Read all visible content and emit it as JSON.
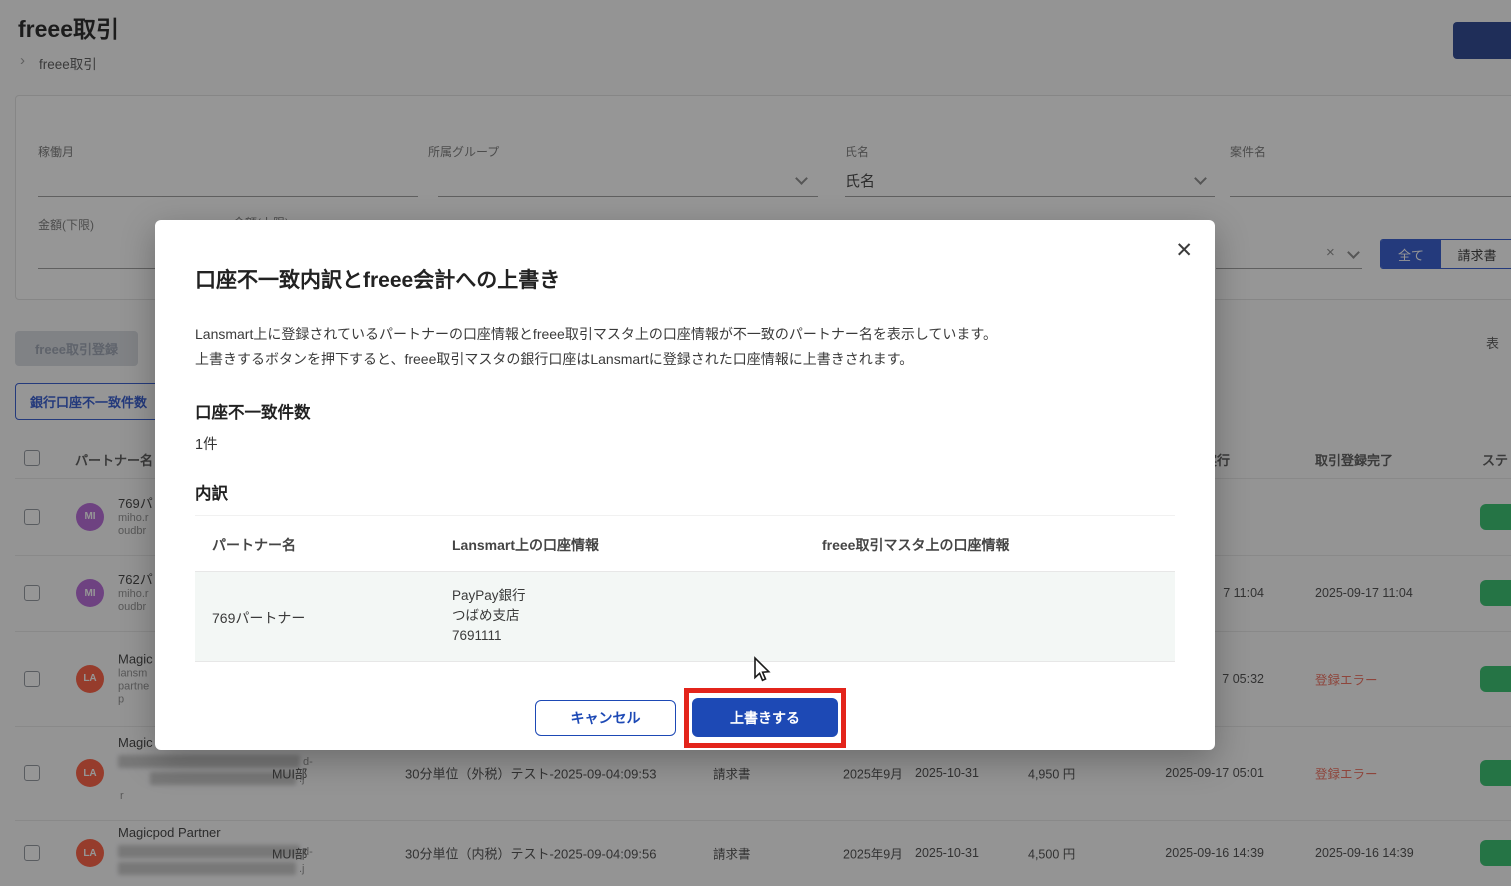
{
  "colors": {
    "accent_blue": "#1d49b5",
    "badge_green": "#2fc06a",
    "error_red": "#f06a58",
    "annotation_red": "#e3241b",
    "avatar_purple": "#b565d9",
    "avatar_red": "#ff5a3c"
  },
  "icons": {
    "breadcrumb_arrow": "›",
    "close": "✕",
    "clear": "×",
    "chevron_down": "chevron-down"
  },
  "header": {
    "title": "freee取引",
    "breadcrumb": "freee取引"
  },
  "filters": {
    "working_month_label": "稼働月",
    "group_label": "所属グループ",
    "name_label": "氏名",
    "name_value": "氏名",
    "project_label": "案件名",
    "amount_lower_label": "金額(下限)",
    "amount_upper_label": "金額(上限)",
    "clear_icon": "×"
  },
  "tabs": {
    "all": "全て",
    "invoice": "請求書"
  },
  "toolbar": {
    "freee_register_label": "freee取引登録",
    "bank_mismatch_label": "銀行口座不一致件数",
    "display_fragment": "表"
  },
  "bg_table": {
    "headers": {
      "partner": "パートナー名",
      "exec_fragment": "実行",
      "registered": "取引登録完了",
      "status_fragment": "ステ"
    },
    "rows": [
      {
        "avatar": "MI",
        "name": "769パ",
        "email1": "miho.r",
        "email2": "oudbr",
        "email3": "",
        "group": "",
        "subject": "",
        "type": "",
        "month": "",
        "due": "",
        "amount": "",
        "exec": "",
        "registered": "",
        "error": false
      },
      {
        "avatar": "MI",
        "name": "762パ",
        "email1": "miho.r",
        "email2": "oudbr",
        "email3": "",
        "group": "",
        "subject": "",
        "type": "",
        "month": "",
        "due": "",
        "amount": "",
        "exec": "7 11:04",
        "registered": "2025-09-17 11:04",
        "error": false
      },
      {
        "avatar": "LA",
        "name": "Magic",
        "email1": "lansm",
        "email2": "partne",
        "email3": "p",
        "group": "",
        "subject": "",
        "type": "",
        "month": "",
        "due": "",
        "amount": "",
        "exec": "7 05:32",
        "registered": "登録エラー",
        "error": true
      },
      {
        "avatar": "LA",
        "name": "Magic",
        "email1": "",
        "email2": "",
        "email3": "r",
        "email_frag1": "d-",
        "email_frag2": ".j",
        "group": "MUI部",
        "subject": "30分単位（外税）テスト-2025-09-04:09:53",
        "type": "請求書",
        "month": "2025年9月",
        "due": "2025-10-31",
        "amount": "4,950 円",
        "exec": "2025-09-17 05:01",
        "registered": "登録エラー",
        "error": true
      },
      {
        "avatar": "LA",
        "name": "Magicpod Partner",
        "email1": "",
        "email2": "",
        "email3": "",
        "email_frag1": "d-",
        "email_frag2": ".j",
        "group": "MUI部",
        "subject": "30分単位（内税）テスト-2025-09-04:09:56",
        "type": "請求書",
        "month": "2025年9月",
        "due": "2025-10-31",
        "amount": "4,500 円",
        "exec": "2025-09-16 14:39",
        "registered": "2025-09-16 14:39",
        "error": false
      }
    ]
  },
  "modal": {
    "title": "口座不一致内訳とfreee会計への上書き",
    "close_icon": "✕",
    "description_line1": "Lansmart上に登録されているパートナーの口座情報とfreee取引マスタ上の口座情報が不一致のパートナー名を表示しています。",
    "description_line2": "上書きするボタンを押下すると、freee取引マスタの銀行口座はLansmartに登録された口座情報に上書きされます。",
    "count_heading": "口座不一致件数",
    "count_value": "1件",
    "breakdown_heading": "内訳",
    "table": {
      "header_partner": "パートナー名",
      "header_lansmart": "Lansmart上の口座情報",
      "header_freee": "freee取引マスタ上の口座情報",
      "row": {
        "partner": "769パートナー",
        "bank_line1": "PayPay銀行",
        "bank_line2": "つばめ支店",
        "bank_line3": "7691111",
        "freee_value": ""
      }
    },
    "cancel_label": "キャンセル",
    "confirm_label": "上書きする"
  }
}
